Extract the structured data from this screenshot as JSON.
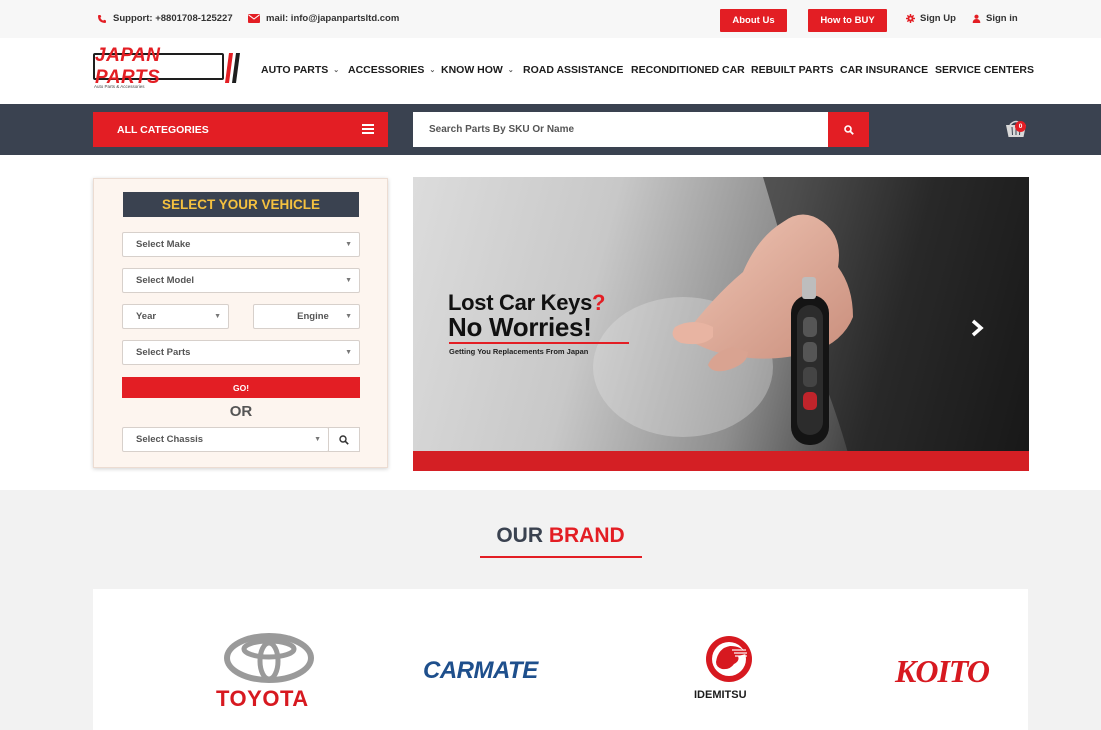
{
  "topbar": {
    "support": "Support: +8801708-125227",
    "mail": "mail: info@japanpartsltd.com",
    "about": "About Us",
    "how_to_buy": "How to BUY",
    "sign_up": "Sign Up",
    "sign_in": "Sign in"
  },
  "logo": {
    "name": "JAPAN PARTS",
    "tagline": "Auto Parts & Accessories"
  },
  "nav": [
    {
      "label": "AUTO PARTS",
      "dropdown": true
    },
    {
      "label": "ACCESSORIES",
      "dropdown": true
    },
    {
      "label": "KNOW HOW",
      "dropdown": true
    },
    {
      "label": "ROAD ASSISTANCE",
      "dropdown": false
    },
    {
      "label": "RECONDITIONED CAR",
      "dropdown": false
    },
    {
      "label": "REBUILT PARTS",
      "dropdown": false
    },
    {
      "label": "CAR INSURANCE",
      "dropdown": false
    },
    {
      "label": "SERVICE CENTERS",
      "dropdown": false
    }
  ],
  "searchbar": {
    "all_categories": "ALL CATEGORIES",
    "placeholder": "Search Parts By SKU Or Name",
    "cart_count": "0"
  },
  "vehicle": {
    "title": "SELECT YOUR VEHICLE",
    "make": "Select Make",
    "model": "Select Model",
    "year": "Year",
    "engine": "Engine",
    "parts": "Select Parts",
    "go": "GO!",
    "or": "OR",
    "chassis": "Select Chassis"
  },
  "banner": {
    "line1": "Lost Car Keys",
    "line1_mark": "?",
    "line2": "No Worries!",
    "sub": "Getting You Replacements From Japan"
  },
  "brands": {
    "title_dark": "OUR",
    "title_red": "BRAND",
    "items": [
      "TOYOTA",
      "CARMATE",
      "IDEMITSU",
      "KOITO"
    ]
  },
  "colors": {
    "accent": "#e31e24",
    "dark": "#3a4250",
    "title_yellow": "#f5c13f"
  }
}
